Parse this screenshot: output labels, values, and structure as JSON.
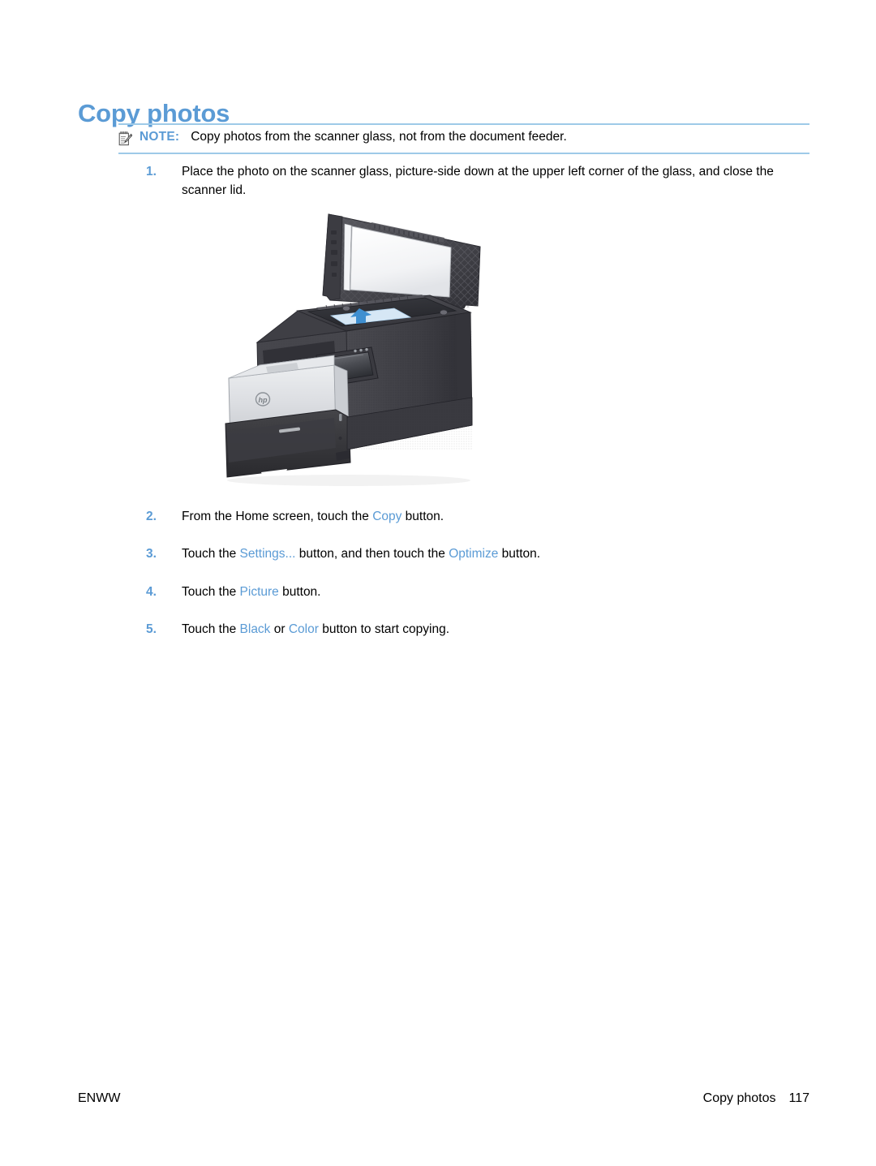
{
  "page": {
    "title": "Copy photos"
  },
  "note": {
    "icon": "note-pencil-icon",
    "label": "NOTE:",
    "text": "Copy photos from the scanner glass, not from the document feeder.",
    "rule_color": "#9ecae8"
  },
  "steps": [
    {
      "number": "1.",
      "parts": [
        {
          "text": "Place the photo on the scanner glass, picture-side down at the upper left corner of the glass, and close the scanner lid.",
          "style": "plain"
        }
      ]
    },
    {
      "number": "2.",
      "parts": [
        {
          "text": "From the Home screen, touch the ",
          "style": "plain"
        },
        {
          "text": "Copy",
          "style": "ui"
        },
        {
          "text": " button.",
          "style": "plain"
        }
      ]
    },
    {
      "number": "3.",
      "parts": [
        {
          "text": "Touch the ",
          "style": "plain"
        },
        {
          "text": "Settings...",
          "style": "ui"
        },
        {
          "text": " button, and then touch the ",
          "style": "plain"
        },
        {
          "text": "Optimize",
          "style": "ui"
        },
        {
          "text": " button.",
          "style": "plain"
        }
      ]
    },
    {
      "number": "4.",
      "parts": [
        {
          "text": "Touch the ",
          "style": "plain"
        },
        {
          "text": "Picture",
          "style": "ui"
        },
        {
          "text": " button.",
          "style": "plain"
        }
      ]
    },
    {
      "number": "5.",
      "parts": [
        {
          "text": "Touch the ",
          "style": "plain"
        },
        {
          "text": "Black",
          "style": "ui"
        },
        {
          "text": " or ",
          "style": "plain"
        },
        {
          "text": "Color",
          "style": "ui"
        },
        {
          "text": " button to start copying.",
          "style": "plain"
        }
      ]
    }
  ],
  "illustration": {
    "name": "mfp-printer-scanner-lid-open-illustration",
    "description": "HP multifunction laser printer with scanner lid open, photo placed face down on the glass, blue arrow indicating placement direction"
  },
  "footer": {
    "left": "ENWW",
    "chapter": "Copy photos",
    "page_number": "117"
  },
  "colors": {
    "heading_blue": "#5b9bd5",
    "ui_blue": "#5b9bd5",
    "rule_blue": "#9ecae8",
    "body_text": "#000000"
  }
}
